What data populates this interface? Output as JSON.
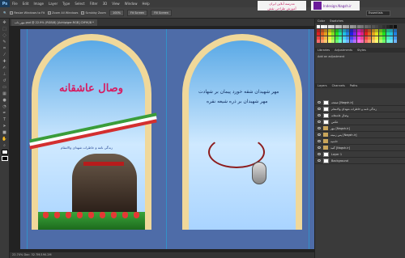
{
  "app": {
    "logo": "Ps"
  },
  "menu": [
    "File",
    "Edit",
    "Image",
    "Layer",
    "Type",
    "Select",
    "Filter",
    "3D",
    "View",
    "Window",
    "Help"
  ],
  "options": {
    "resize_windows": "Resize Windows to Fit",
    "zoom_all": "Zoom All Windows",
    "scrubby": "Scrubby Zoom",
    "actual_pixels": "100%",
    "fit_screen": "Fit Screen",
    "fill_screen": "Fill Screen"
  },
  "banners": {
    "school_line1": "مدرسه آنلاین ایران",
    "school_line2": "آموزش طراحی نقش",
    "website": "Indesign.Nagsh.ir"
  },
  "workspace": "Essentials",
  "document": {
    "tab_title": "مهر_تاب.psd @ 22.9% (RGB/8) [Achtpiger.RGB] CMYK/8 *",
    "status": "22.74% Doc: 32.7M/190.2M"
  },
  "artwork": {
    "left_title": "وصال عاشقانه",
    "left_subtitle": "زندگی نامه و خاطرات شهدای والامقام",
    "right_line1": "مهر شهیدان شقه خورد پیمان بر شهادت",
    "right_line2": "مهر شهیدان بر ذره شیعه نقره"
  },
  "panels": {
    "color_tabs": [
      "Color",
      "Swatches"
    ],
    "adjust_tabs": [
      "Libraries",
      "Adjustments",
      "Styles"
    ],
    "add_adjustment": "Add an adjustment",
    "layers_tabs": [
      "Layers",
      "Channels",
      "Paths"
    ],
    "layers": [
      {
        "name": "صفحه [Nagsh.ir]",
        "type": "text"
      },
      {
        "name": "زندگی نامه و خاطرات شهدای والامقام",
        "type": "text"
      },
      {
        "name": "وصال عاشقانه",
        "type": "text"
      },
      {
        "name": "عکس",
        "type": "image"
      },
      {
        "name": "مهر [Nagsh.ir]",
        "type": "group"
      },
      {
        "name": "پس زمینه [Nagsh.ir]",
        "type": "group"
      },
      {
        "name": "حاشیه",
        "type": "group"
      },
      {
        "name": "گنبد [Nagsh.ir]",
        "type": "group"
      },
      {
        "name": "Layer 1",
        "type": "image"
      },
      {
        "name": "Background",
        "type": "image"
      }
    ]
  },
  "colors": {
    "accent_pink": "#d81b60",
    "sky_blue": "#5aa9e6",
    "frame_gold": "#f0d89a",
    "bg_blue": "#4e6ca8"
  }
}
